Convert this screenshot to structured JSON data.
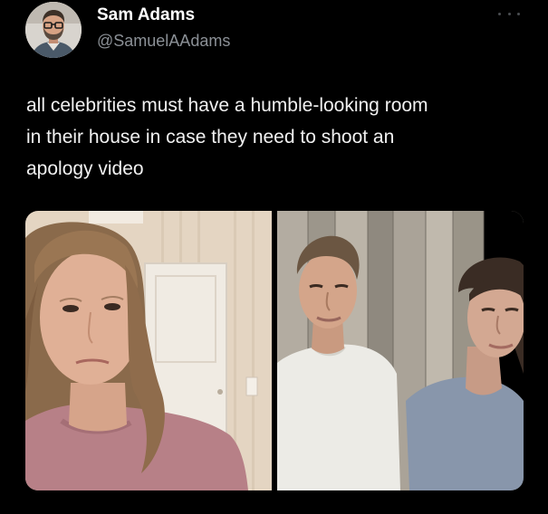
{
  "author": {
    "display_name": "Sam Adams",
    "handle": "@SamuelAAdams"
  },
  "tweet": {
    "text_lines": [
      "all celebrities must have a humble-looking room",
      "in their house in case they need to shoot an",
      "apology video"
    ]
  },
  "icons": {
    "more": "more-horizontal-icon"
  },
  "colors": {
    "background": "#000000",
    "name": "#ffffff",
    "handle": "#8b9096",
    "body_text": "#f1f1f1"
  }
}
